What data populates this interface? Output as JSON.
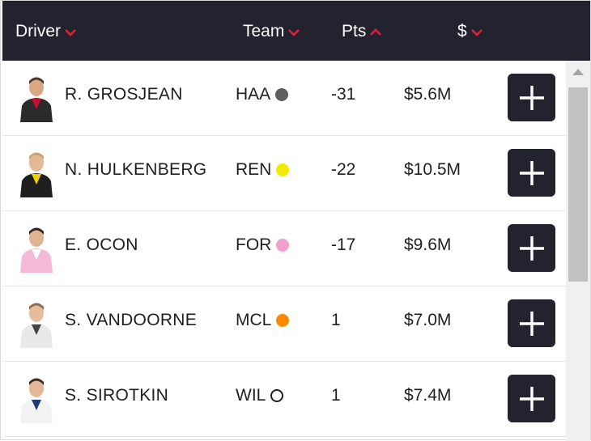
{
  "header": {
    "columns": [
      {
        "label": "Driver",
        "sort": "desc"
      },
      {
        "label": "Team",
        "sort": "desc"
      },
      {
        "label": "Pts",
        "sort": "asc"
      },
      {
        "label": "$",
        "sort": "desc"
      }
    ]
  },
  "colors": {
    "header_bg": "#23222f",
    "sort_arrow": "#e0203a",
    "button_bg": "#23222f"
  },
  "drivers": [
    {
      "name": "R. GROSJEAN",
      "team": "HAA",
      "team_color": "#5f5f5f",
      "team_dot_style": "filled",
      "pts": "-31",
      "price": "$5.6M",
      "suit": "#2b2b2b",
      "suit_accent": "#c4122f",
      "add_icon": "plus-icon"
    },
    {
      "name": "N. HULKENBERG",
      "team": "REN",
      "team_color": "#f2ea00",
      "team_dot_style": "filled",
      "pts": "-22",
      "price": "$10.5M",
      "suit": "#1f1f1f",
      "suit_accent": "#f2d100",
      "add_icon": "plus-icon"
    },
    {
      "name": "E. OCON",
      "team": "FOR",
      "team_color": "#f29fcb",
      "team_dot_style": "filled",
      "pts": "-17",
      "price": "$9.6M",
      "suit": "#f4b9d5",
      "suit_accent": "#ffffff",
      "add_icon": "plus-icon"
    },
    {
      "name": "S. VANDOORNE",
      "team": "MCL",
      "team_color": "#ff8a00",
      "team_dot_style": "filled",
      "pts": "1",
      "price": "$7.0M",
      "suit": "#e9e9e9",
      "suit_accent": "#444444",
      "add_icon": "plus-icon"
    },
    {
      "name": "S. SIROTKIN",
      "team": "WIL",
      "team_color": "#1f1f1f",
      "team_dot_style": "outline",
      "pts": "1",
      "price": "$7.4M",
      "suit": "#f2f2f2",
      "suit_accent": "#1e3a78",
      "add_icon": "plus-icon"
    }
  ]
}
